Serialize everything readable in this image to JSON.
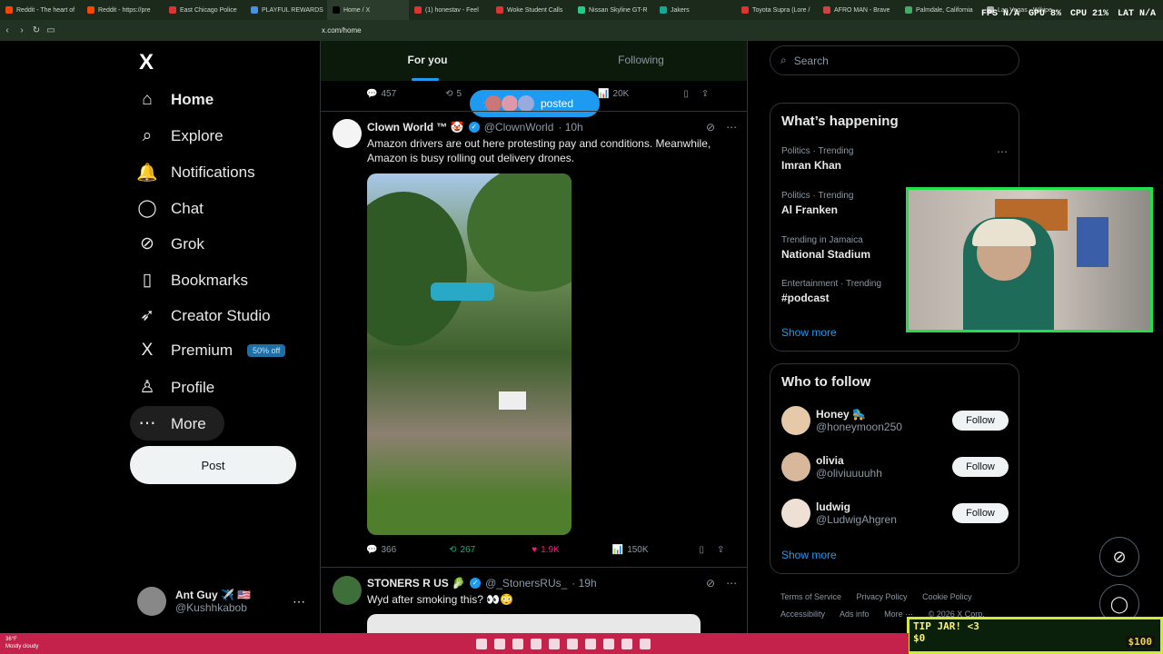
{
  "browser": {
    "tabs": [
      "Reddit - The heart of",
      "Reddit - https://pre",
      "East Chicago Police",
      "PLAYFUL REWARDS",
      "Home / X",
      "(1) honestav - Feel",
      "Woke Student Calls",
      "Nissan Skyline GT-R",
      "Jakers",
      "Toyota Supra (Lore /",
      "AFRO MAN - Brave",
      "Palmdale, California",
      "Las Vegas - Wikipe"
    ],
    "url": "x.com/home",
    "perf": {
      "fps": "FPS N/A",
      "gpu": "GPU 8%",
      "cpu": "CPU 21%",
      "lat": "LAT N/A"
    }
  },
  "nav": {
    "logo": "X",
    "items": [
      {
        "label": "Home",
        "icon": "home-icon",
        "glyph": "⌂"
      },
      {
        "label": "Explore",
        "icon": "search-icon",
        "glyph": "⌕"
      },
      {
        "label": "Notifications",
        "icon": "bell-icon",
        "glyph": "🔔"
      },
      {
        "label": "Chat",
        "icon": "chat-icon",
        "glyph": "◯"
      },
      {
        "label": "Grok",
        "icon": "grok-icon",
        "glyph": "⊘"
      },
      {
        "label": "Bookmarks",
        "icon": "bookmark-icon",
        "glyph": "▯"
      },
      {
        "label": "Creator Studio",
        "icon": "rocket-icon",
        "glyph": "➶"
      },
      {
        "label": "Premium",
        "icon": "x-icon",
        "glyph": "X"
      },
      {
        "label": "Profile",
        "icon": "person-icon",
        "glyph": "♙"
      },
      {
        "label": "More",
        "icon": "more-circle-icon",
        "glyph": "⋯"
      }
    ],
    "premium_badge": "50% off",
    "post_label": "Post",
    "account": {
      "name": "Ant Guy ✈️ 🇺🇸",
      "handle": "@Kushhkabob",
      "dots": "⋯"
    }
  },
  "feed": {
    "tabs": [
      "For you",
      "Following"
    ],
    "top_actions": {
      "replies": "457",
      "reposts": "5",
      "views": "20K"
    },
    "posted_pill": "posted",
    "tweet1": {
      "name": "Clown World ™ 🤡",
      "handle": "@ClownWorld",
      "time": "· 10h",
      "text": "Amazon drivers are out here protesting pay and conditions. Meanwhile, Amazon is busy rolling out delivery drones.",
      "replies": "366",
      "reposts": "267",
      "likes": "1.9K",
      "views": "150K"
    },
    "tweet2": {
      "name": "STONERS R US 🥬",
      "handle": "@_StonersRUs_",
      "time": "· 19h",
      "text": "Wyd after smoking this? 👀😳"
    }
  },
  "right": {
    "search_placeholder": "Search",
    "happening_title": "What’s happening",
    "trends": [
      {
        "meta": "Politics · Trending",
        "topic": "Imran Khan"
      },
      {
        "meta": "Politics · Trending",
        "topic": "Al Franken"
      },
      {
        "meta": "Trending in Jamaica",
        "topic": "National Stadium"
      },
      {
        "meta": "Entertainment · Trending",
        "topic": "#podcast"
      }
    ],
    "show_more": "Show more",
    "wtf_title": "Who to follow",
    "wtf": [
      {
        "name": "Honey 🛼",
        "handle": "@honeymoon250",
        "btn": "Follow"
      },
      {
        "name": "olivia",
        "handle": "@oliviuuuuhh",
        "btn": "Follow"
      },
      {
        "name": "ludwig",
        "handle": "@LudwigAhgren",
        "btn": "Follow"
      }
    ],
    "footer": [
      "Terms of Service",
      "Privacy Policy",
      "Cookie Policy",
      "Accessibility",
      "Ads info",
      "More ···",
      "© 2026 X Corp."
    ]
  },
  "overlay": {
    "tipjar_title": "TIP JAR! <3",
    "tipjar_left": "$0",
    "tipjar_right": "$100"
  },
  "taskbar": {
    "weather_temp": "36°F",
    "weather_desc": "Mostly cloudy"
  }
}
